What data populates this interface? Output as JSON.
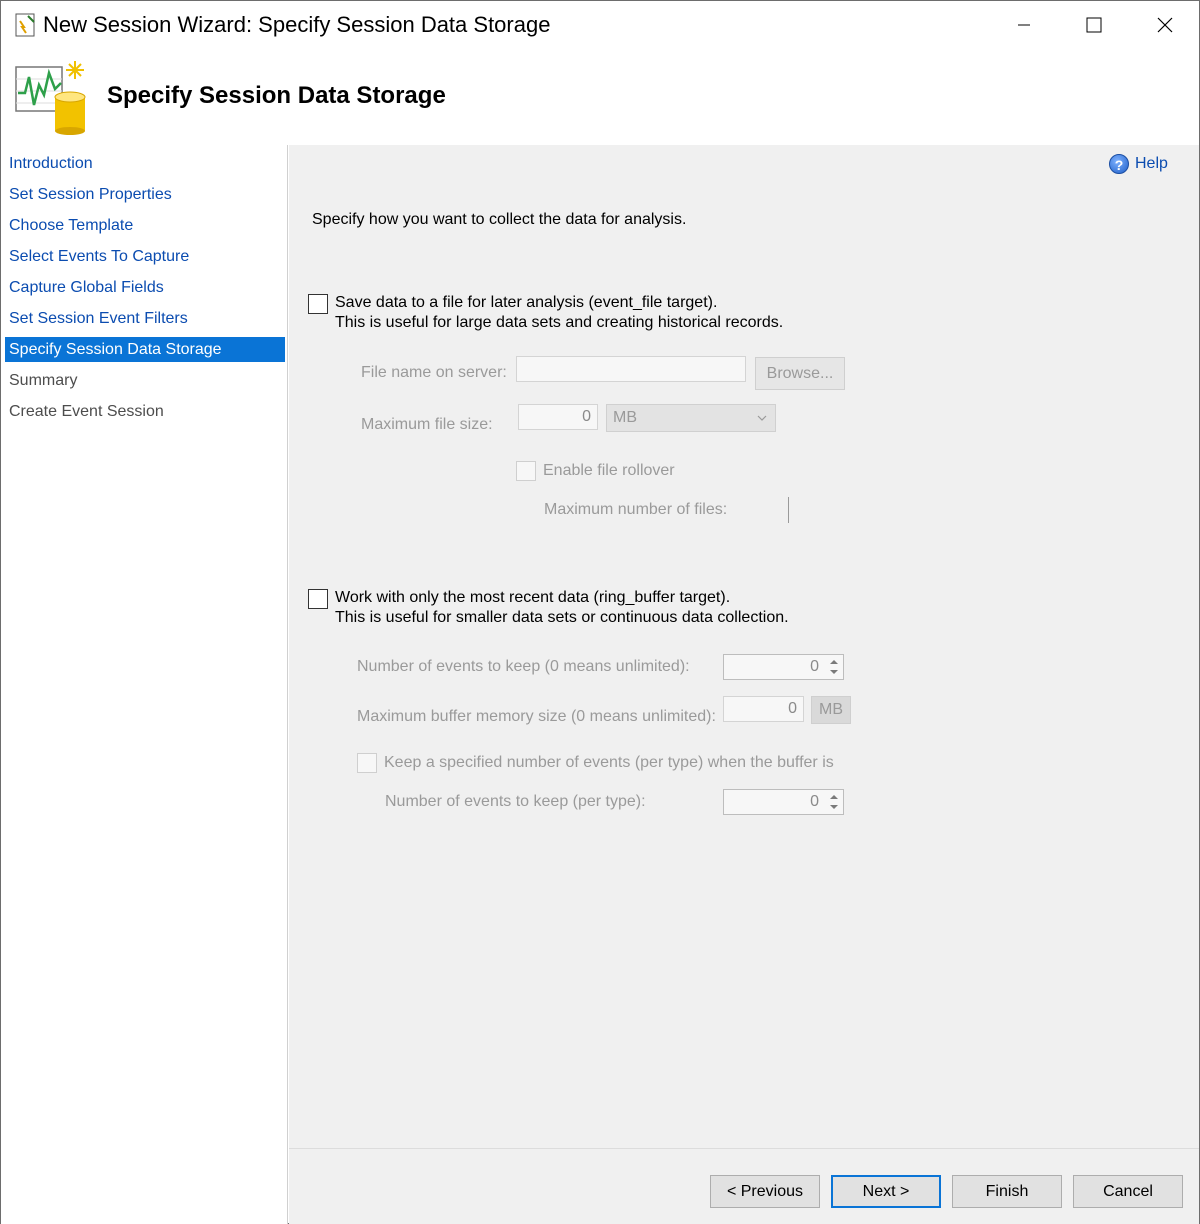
{
  "window": {
    "title": "New Session Wizard: Specify Session Data Storage"
  },
  "header": {
    "title": "Specify Session Data Storage",
    "icon": "session-storage-wizard-icon"
  },
  "nav": {
    "items": [
      {
        "label": "Introduction",
        "state": "link"
      },
      {
        "label": "Set Session Properties",
        "state": "link"
      },
      {
        "label": "Choose Template",
        "state": "link"
      },
      {
        "label": "Select Events To Capture",
        "state": "link"
      },
      {
        "label": "Capture Global Fields",
        "state": "link"
      },
      {
        "label": "Set Session Event Filters",
        "state": "link"
      },
      {
        "label": "Specify Session Data Storage",
        "state": "active"
      },
      {
        "label": "Summary",
        "state": "disabled"
      },
      {
        "label": "Create Event Session",
        "state": "disabled"
      }
    ]
  },
  "content": {
    "help_label": "Help",
    "intro": "Specify how you want to collect the data for analysis.",
    "file_target": {
      "checked": false,
      "label": "Save data to a file for later analysis (event_file target).",
      "description": "This is useful for large data sets and creating historical records.",
      "file_name_label": "File name on server:",
      "file_name_value": "",
      "browse_label": "Browse...",
      "max_size_label": "Maximum file size:",
      "max_size_value": "0",
      "max_size_unit": "MB",
      "rollover_label": "Enable file rollover",
      "rollover_checked": false,
      "max_files_label": "Maximum number of files:"
    },
    "ring_buffer": {
      "checked": false,
      "label": "Work with only the most recent data (ring_buffer target).",
      "description": "This is useful for smaller data sets or continuous data collection.",
      "events_keep_label": "Number of events to keep (0 means unlimited):",
      "events_keep_value": "0",
      "buffer_size_label": "Maximum buffer memory size (0 means unlimited):",
      "buffer_size_value": "0",
      "buffer_size_unit": "MB",
      "per_type_label": "Keep a specified number of events (per type) when the buffer is",
      "per_type_checked": false,
      "per_type_count_label": "Number of events to keep (per type):",
      "per_type_count_value": "0"
    }
  },
  "footer": {
    "previous": "< Previous",
    "next": "Next >",
    "finish": "Finish",
    "cancel": "Cancel"
  },
  "colors": {
    "link": "#0b4cb0",
    "active_bg": "#0a74d6",
    "panel_bg": "#f0f0f0"
  }
}
